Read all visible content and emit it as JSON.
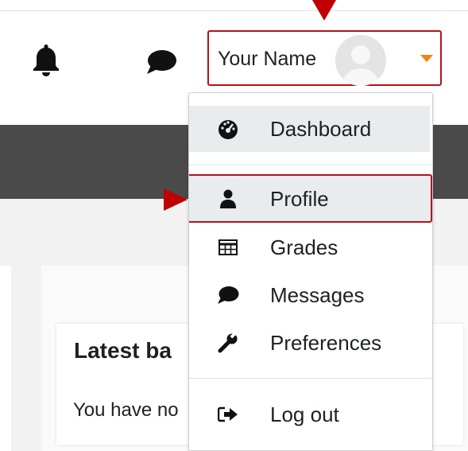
{
  "navbar": {
    "notifications_icon": "bell-icon",
    "messages_icon": "chat-bubble-icon",
    "user_menu": {
      "name": "Your Name",
      "avatar_icon": "default-avatar-icon",
      "caret_icon": "caret-down-icon",
      "caret_color": "#f98012"
    }
  },
  "dropdown": {
    "items": [
      {
        "label": "Dashboard",
        "icon": "dashboard-gauge-icon"
      },
      {
        "label": "Profile",
        "icon": "user-icon"
      },
      {
        "label": "Grades",
        "icon": "table-icon"
      },
      {
        "label": "Messages",
        "icon": "chat-bubble-icon"
      },
      {
        "label": "Preferences",
        "icon": "wrench-icon"
      },
      {
        "label": "Log out",
        "icon": "sign-out-icon"
      }
    ]
  },
  "page": {
    "block_title": "Latest ba",
    "block_text": "You have no"
  },
  "colors": {
    "highlight": "#b3121a",
    "annotation_arrow": "#c00000",
    "dark_bar": "#4a4a4a",
    "active_item_bg": "#e9ecef"
  }
}
